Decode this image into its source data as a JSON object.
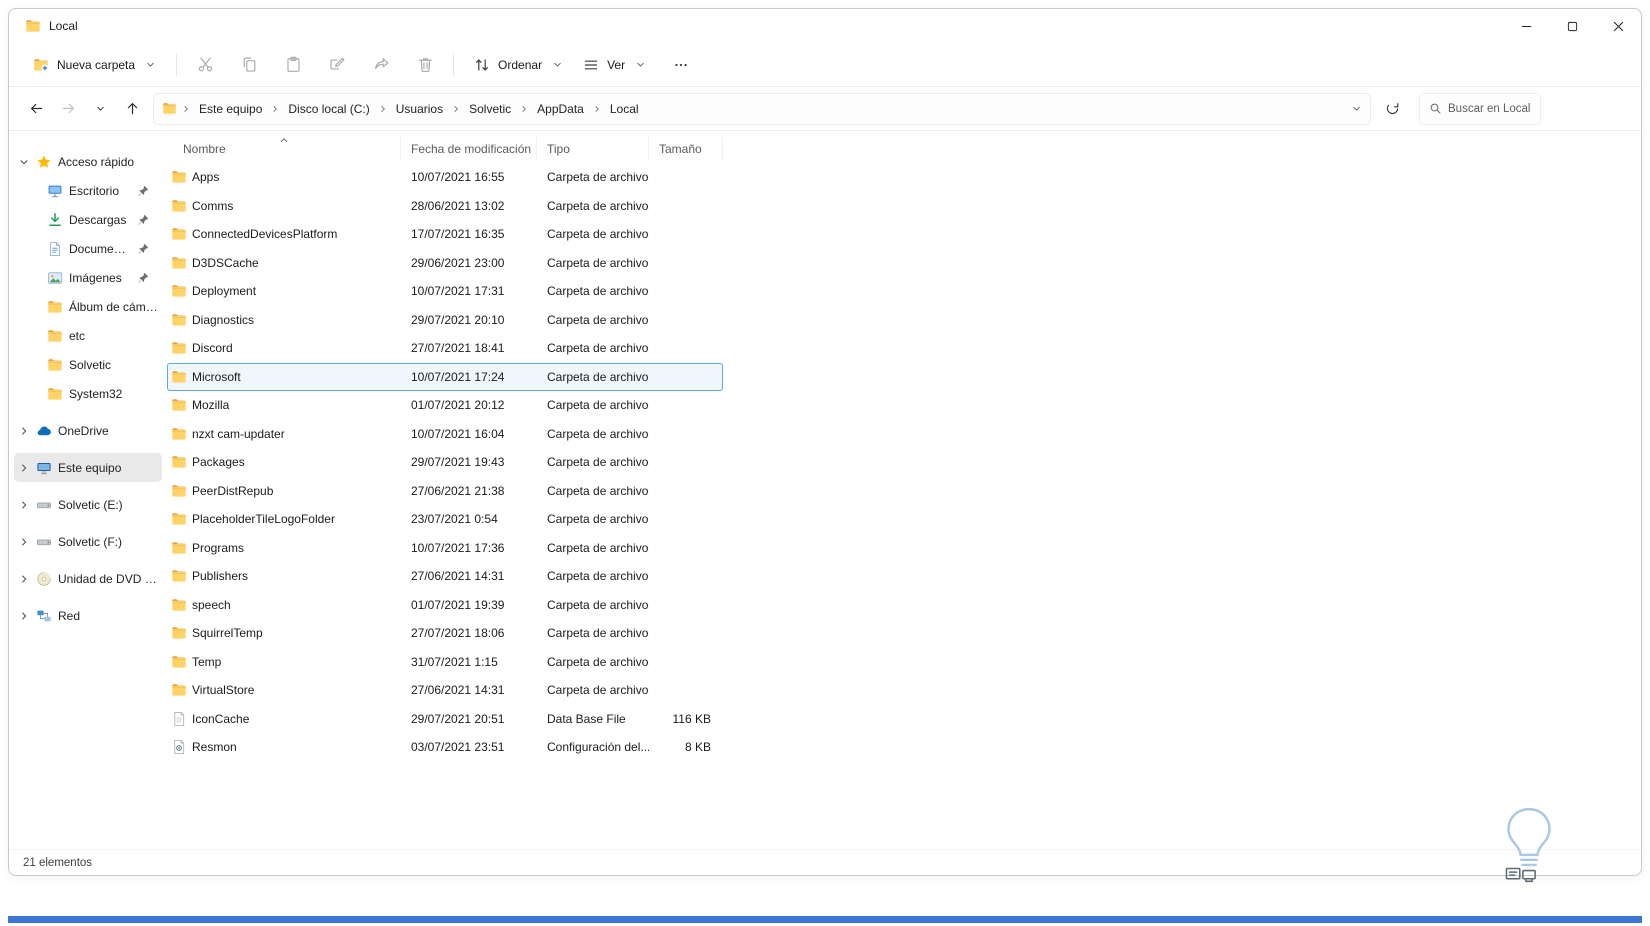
{
  "window": {
    "title": "Local",
    "controls": [
      {
        "icon": "minimize-icon"
      },
      {
        "icon": "maximize-icon"
      },
      {
        "icon": "close-icon"
      }
    ]
  },
  "toolbar": {
    "new_folder_label": "Nueva carpeta",
    "actions": [
      {
        "icon": "cut-icon"
      },
      {
        "icon": "copy-icon"
      },
      {
        "icon": "paste-icon"
      },
      {
        "icon": "rename-icon"
      },
      {
        "icon": "share-icon"
      },
      {
        "icon": "delete-icon"
      }
    ],
    "sort_label": "Ordenar",
    "view_label": "Ver",
    "more_icon": "more-icon"
  },
  "addressbar": {
    "nav": [
      {
        "icon": "back-icon",
        "enabled": true
      },
      {
        "icon": "forward-icon",
        "enabled": false
      },
      {
        "icon": "chevron-down-icon",
        "enabled": true,
        "small": true
      },
      {
        "icon": "up-icon",
        "enabled": true
      }
    ],
    "breadcrumbs": [
      "Este equipo",
      "Disco local (C:)",
      "Usuarios",
      "Solvetic",
      "AppData",
      "Local"
    ],
    "search_placeholder": "Buscar en Local"
  },
  "sidebar": {
    "items": [
      {
        "label": "Acceso rápido",
        "icon": "star-icon",
        "expander": "down",
        "level": 0
      },
      {
        "label": "Escritorio",
        "icon": "desktop-icon",
        "level": 1,
        "pinned": true
      },
      {
        "label": "Descargas",
        "icon": "downloads-icon",
        "level": 1,
        "pinned": true
      },
      {
        "label": "Documentos",
        "icon": "documents-icon",
        "level": 1,
        "pinned": true
      },
      {
        "label": "Imágenes",
        "icon": "pictures-icon",
        "level": 1,
        "pinned": true
      },
      {
        "label": "Álbum de cámara",
        "icon": "folder-icon",
        "level": 1
      },
      {
        "label": "etc",
        "icon": "folder-icon",
        "level": 1
      },
      {
        "label": "Solvetic",
        "icon": "folder-icon",
        "level": 1
      },
      {
        "label": "System32",
        "icon": "folder-icon",
        "level": 1
      },
      {
        "label": "OneDrive",
        "icon": "onedrive-icon",
        "expander": "right",
        "level": 0,
        "section": true
      },
      {
        "label": "Este equipo",
        "icon": "computer-icon",
        "expander": "right",
        "level": 0,
        "section": true,
        "selected": true
      },
      {
        "label": "Solvetic (E:)",
        "icon": "drive-icon",
        "expander": "right",
        "level": 0,
        "section": true
      },
      {
        "label": "Solvetic (F:)",
        "icon": "drive-icon",
        "expander": "right",
        "level": 0,
        "section": true
      },
      {
        "label": "Unidad de DVD (D:)",
        "icon": "dvd-icon",
        "expander": "right",
        "level": 0,
        "section": true
      },
      {
        "label": "Red",
        "icon": "network-icon",
        "expander": "right",
        "level": 0,
        "section": true
      }
    ]
  },
  "files": {
    "columns": [
      {
        "label": "Nombre",
        "sort": "asc"
      },
      {
        "label": "Fecha de modificación"
      },
      {
        "label": "Tipo"
      },
      {
        "label": "Tamaño"
      }
    ],
    "rows": [
      {
        "name": "Apps",
        "date": "10/07/2021 16:55",
        "type": "Carpeta de archivos",
        "size": "",
        "icon": "folder-icon"
      },
      {
        "name": "Comms",
        "date": "28/06/2021 13:02",
        "type": "Carpeta de archivos",
        "size": "",
        "icon": "folder-icon"
      },
      {
        "name": "ConnectedDevicesPlatform",
        "date": "17/07/2021 16:35",
        "type": "Carpeta de archivos",
        "size": "",
        "icon": "folder-icon"
      },
      {
        "name": "D3DSCache",
        "date": "29/06/2021 23:00",
        "type": "Carpeta de archivos",
        "size": "",
        "icon": "folder-icon"
      },
      {
        "name": "Deployment",
        "date": "10/07/2021 17:31",
        "type": "Carpeta de archivos",
        "size": "",
        "icon": "folder-icon"
      },
      {
        "name": "Diagnostics",
        "date": "29/07/2021 20:10",
        "type": "Carpeta de archivos",
        "size": "",
        "icon": "folder-icon"
      },
      {
        "name": "Discord",
        "date": "27/07/2021 18:41",
        "type": "Carpeta de archivos",
        "size": "",
        "icon": "folder-icon"
      },
      {
        "name": "Microsoft",
        "date": "10/07/2021 17:24",
        "type": "Carpeta de archivos",
        "size": "",
        "icon": "folder-icon",
        "selected": true
      },
      {
        "name": "Mozilla",
        "date": "01/07/2021 20:12",
        "type": "Carpeta de archivos",
        "size": "",
        "icon": "folder-icon"
      },
      {
        "name": "nzxt cam-updater",
        "date": "10/07/2021 16:04",
        "type": "Carpeta de archivos",
        "size": "",
        "icon": "folder-icon"
      },
      {
        "name": "Packages",
        "date": "29/07/2021 19:43",
        "type": "Carpeta de archivos",
        "size": "",
        "icon": "folder-icon"
      },
      {
        "name": "PeerDistRepub",
        "date": "27/06/2021 21:38",
        "type": "Carpeta de archivos",
        "size": "",
        "icon": "folder-icon"
      },
      {
        "name": "PlaceholderTileLogoFolder",
        "date": "23/07/2021 0:54",
        "type": "Carpeta de archivos",
        "size": "",
        "icon": "folder-icon"
      },
      {
        "name": "Programs",
        "date": "10/07/2021 17:36",
        "type": "Carpeta de archivos",
        "size": "",
        "icon": "folder-icon"
      },
      {
        "name": "Publishers",
        "date": "27/06/2021 14:31",
        "type": "Carpeta de archivos",
        "size": "",
        "icon": "folder-icon"
      },
      {
        "name": "speech",
        "date": "01/07/2021 19:39",
        "type": "Carpeta de archivos",
        "size": "",
        "icon": "folder-icon"
      },
      {
        "name": "SquirrelTemp",
        "date": "27/07/2021 18:06",
        "type": "Carpeta de archivos",
        "size": "",
        "icon": "folder-icon"
      },
      {
        "name": "Temp",
        "date": "31/07/2021 1:15",
        "type": "Carpeta de archivos",
        "size": "",
        "icon": "folder-icon"
      },
      {
        "name": "VirtualStore",
        "date": "27/06/2021 14:31",
        "type": "Carpeta de archivos",
        "size": "",
        "icon": "folder-icon"
      },
      {
        "name": "IconCache",
        "date": "29/07/2021 20:51",
        "type": "Data Base File",
        "size": "116 KB",
        "icon": "file-icon"
      },
      {
        "name": "Resmon",
        "date": "03/07/2021 23:51",
        "type": "Configuración del...",
        "size": "8 KB",
        "icon": "settings-file-icon"
      }
    ]
  },
  "status": {
    "items_count": "21 elementos"
  },
  "colors": {
    "accent": "#0078d4",
    "selection_border": "#5fa6dd",
    "strip_blue": "#3b76d6",
    "folder_yellow": "#ffd367"
  }
}
